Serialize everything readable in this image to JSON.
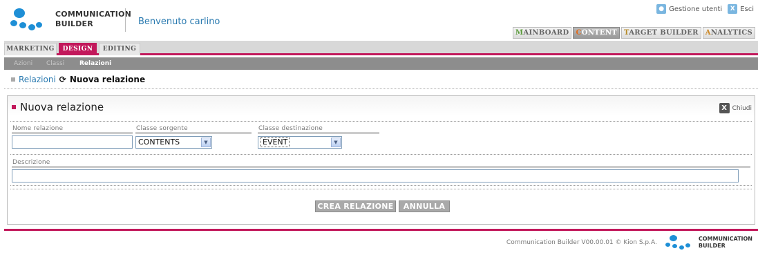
{
  "brand": {
    "line1": "COMMUNICATION",
    "line2": "BUILDER",
    "welcome": "Benvenuto carlino"
  },
  "top_links": {
    "users": "Gestione utenti",
    "logout": "Esci"
  },
  "app_tabs": {
    "first": [
      "M",
      "C",
      "T",
      "A"
    ],
    "rest": [
      "AINBOARD",
      "ONTENT",
      "ARGET BUILDER",
      "NALYTICS"
    ],
    "active": "CONTENT"
  },
  "main_tabs": [
    {
      "label": "MARKETING"
    },
    {
      "label": "DESIGN"
    },
    {
      "label": "EDITING"
    }
  ],
  "sub_tabs": [
    {
      "label": "Azioni"
    },
    {
      "label": "Classi"
    },
    {
      "label": "Relazioni"
    }
  ],
  "breadcrumb": {
    "parent": "Relazioni",
    "current": "Nuova relazione"
  },
  "form": {
    "title": "Nuova relazione",
    "close_label": "Chiudi",
    "name_label": "Nome relazione",
    "name_value": "",
    "source_label": "Classe sorgente",
    "source_value": "CONTENTS",
    "target_label": "Classe destinazione",
    "target_value": "EVENT",
    "desc_label": "Descrizione",
    "desc_value": "",
    "submit": "CREA RELAZIONE",
    "cancel": "ANNULLA"
  },
  "footer": {
    "text": "Communication Builder V00.00.01 © Kion S.p.A.",
    "logo_line1": "COMMUNICATION",
    "logo_line2": "BUILDER"
  },
  "colors": {
    "accent": "#c2185b",
    "link": "#2a7ab0",
    "logo_blue": "#1e8fd6"
  }
}
